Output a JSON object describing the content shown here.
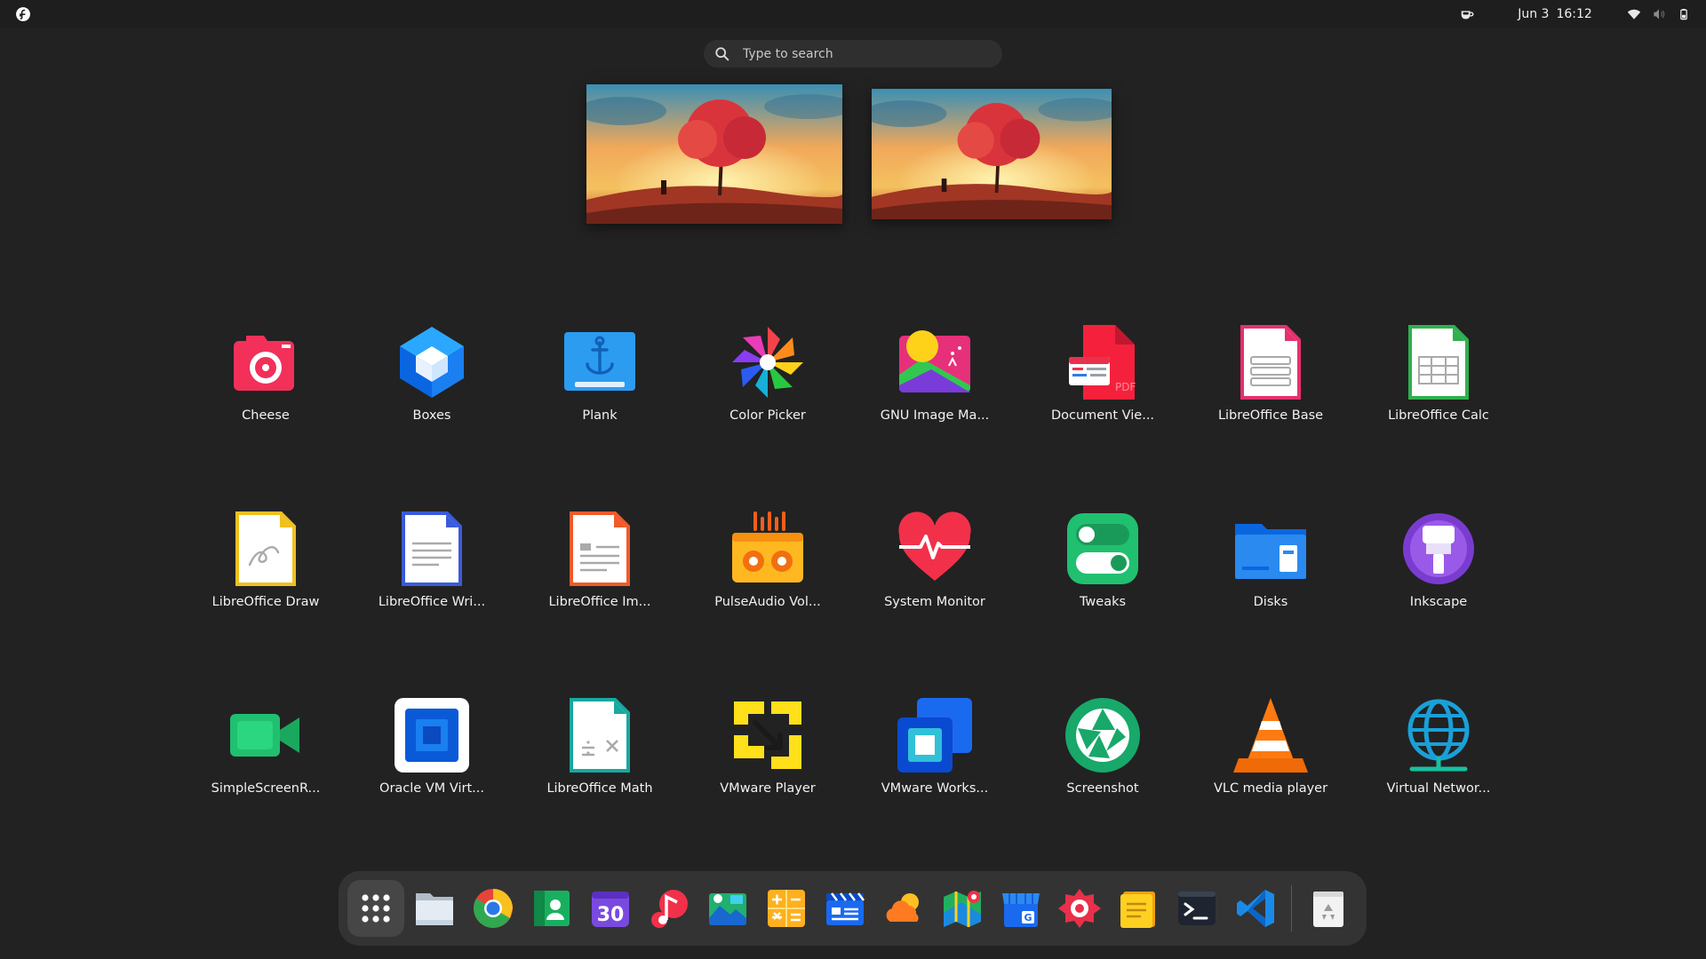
{
  "topbar": {
    "activities_icon": "fedora-logo-icon",
    "date": "Jun 3",
    "time": "16:12",
    "tray": [
      "coffee-cup-icon",
      "wifi-icon",
      "volume-muted-icon",
      "battery-icon"
    ]
  },
  "search": {
    "placeholder": "Type to search"
  },
  "workspaces": [
    {
      "name": "workspace-1",
      "wallpaper": "autumn-tree-sunset"
    },
    {
      "name": "workspace-2",
      "wallpaper": "autumn-tree-sunset"
    }
  ],
  "apps": [
    {
      "label": "Cheese",
      "icon": "cheese-camera-icon"
    },
    {
      "label": "Boxes",
      "icon": "boxes-icon"
    },
    {
      "label": "Plank",
      "icon": "plank-anchor-icon"
    },
    {
      "label": "Color Picker",
      "icon": "color-picker-pinwheel-icon"
    },
    {
      "label": "GNU Image Ma...",
      "icon": "gimp-icon"
    },
    {
      "label": "Document Vie...",
      "icon": "document-viewer-pdf-icon"
    },
    {
      "label": "LibreOffice Base",
      "icon": "libreoffice-base-icon"
    },
    {
      "label": "LibreOffice Calc",
      "icon": "libreoffice-calc-icon"
    },
    {
      "label": "LibreOffice Draw",
      "icon": "libreoffice-draw-icon"
    },
    {
      "label": "LibreOffice Wri...",
      "icon": "libreoffice-writer-icon"
    },
    {
      "label": "LibreOffice Im...",
      "icon": "libreoffice-impress-icon"
    },
    {
      "label": "PulseAudio Vol...",
      "icon": "pulseaudio-radio-icon"
    },
    {
      "label": "System Monitor",
      "icon": "system-monitor-heart-icon"
    },
    {
      "label": "Tweaks",
      "icon": "tweaks-toggles-icon"
    },
    {
      "label": "Disks",
      "icon": "disks-folder-icon"
    },
    {
      "label": "Inkscape",
      "icon": "inkscape-icon"
    },
    {
      "label": "SimpleScreenR...",
      "icon": "screen-recorder-camera-icon"
    },
    {
      "label": "Oracle VM Virt...",
      "icon": "virtualbox-icon"
    },
    {
      "label": "LibreOffice Math",
      "icon": "libreoffice-math-icon"
    },
    {
      "label": "VMware Player",
      "icon": "vmware-player-icon"
    },
    {
      "label": "VMware Works...",
      "icon": "vmware-workstation-icon"
    },
    {
      "label": "Screenshot",
      "icon": "screenshot-shutter-icon"
    },
    {
      "label": "VLC media player",
      "icon": "vlc-cone-icon"
    },
    {
      "label": "Virtual Networ...",
      "icon": "virtual-network-globe-icon"
    }
  ],
  "dock": [
    {
      "name": "show-apps",
      "icon": "app-grid-icon",
      "active": true
    },
    {
      "name": "files",
      "icon": "files-folder-icon"
    },
    {
      "name": "chrome",
      "icon": "chrome-icon"
    },
    {
      "name": "contacts",
      "icon": "contacts-icon"
    },
    {
      "name": "calendar",
      "icon": "calendar-icon",
      "text": "30"
    },
    {
      "name": "music",
      "icon": "music-note-icon"
    },
    {
      "name": "image-viewer",
      "icon": "image-viewer-icon"
    },
    {
      "name": "calculator",
      "icon": "calculator-icon"
    },
    {
      "name": "video-editor",
      "icon": "video-clapper-icon"
    },
    {
      "name": "weather",
      "icon": "weather-cloud-icon"
    },
    {
      "name": "maps",
      "icon": "maps-pin-icon"
    },
    {
      "name": "software",
      "icon": "software-store-icon"
    },
    {
      "name": "screen-recorder",
      "icon": "screen-recorder-icon"
    },
    {
      "name": "notes",
      "icon": "sticky-notes-icon"
    },
    {
      "name": "terminal",
      "icon": "terminal-icon"
    },
    {
      "name": "vscode",
      "icon": "vscode-icon"
    },
    {
      "name": "trash",
      "icon": "trash-icon"
    }
  ],
  "colors": {
    "background": "#222222",
    "dock": "#333333",
    "text": "#f2f2f2"
  }
}
